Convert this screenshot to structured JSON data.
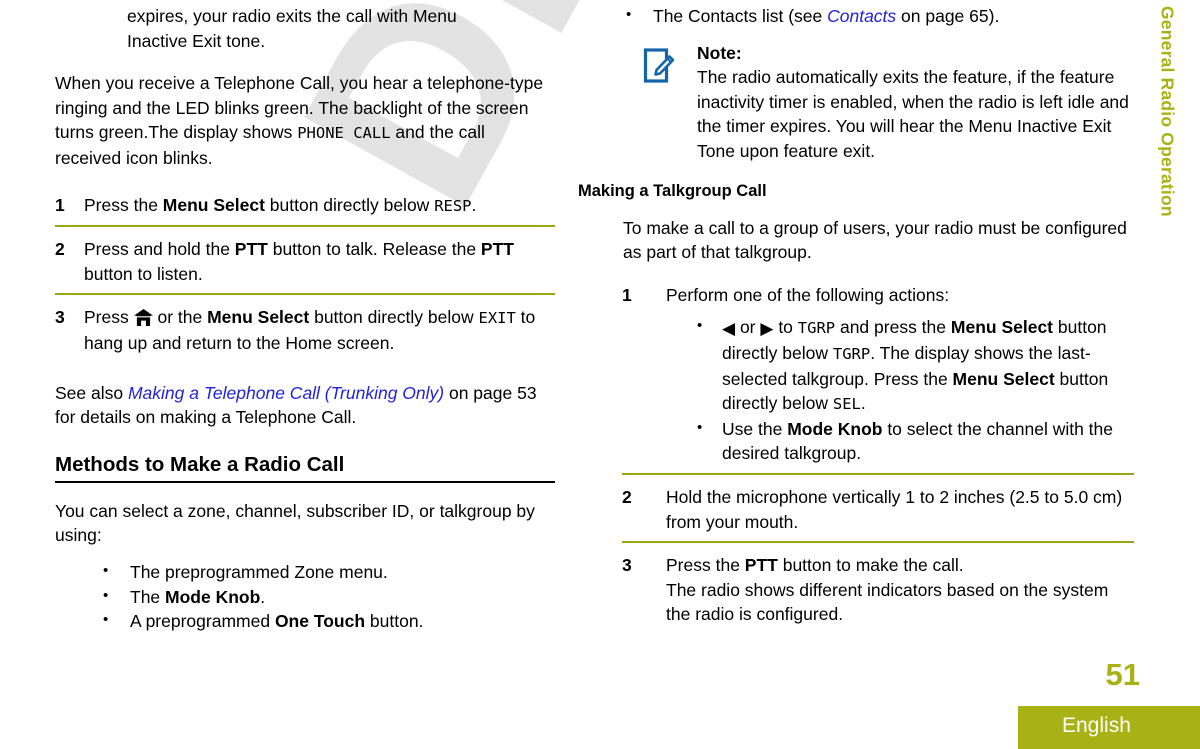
{
  "watermark": {
    "text": "Draft"
  },
  "side_tab": {
    "label": "General Radio Operation",
    "color": "#a8b214"
  },
  "page_number": "51",
  "footer": {
    "language": "English",
    "bar_color": "#a8b214",
    "text_color": "#ffffff"
  },
  "accent": {
    "rule_olive": "#9aa515",
    "rule_black": "#000000",
    "link_blue": "#2222dd",
    "note_icon_blue": "#1464aa"
  },
  "left_column": {
    "continued_paragraph": {
      "line1": "expires, your radio exits the call with Menu",
      "line2": "Inactive Exit tone."
    },
    "telephone_call_paragraph": {
      "text_before": "When you receive a Telephone Call, you hear a telephone-type ringing and the LED blinks green. The backlight of the screen turns green.The display shows ",
      "display_text": "PHONE CALL",
      "text_after": " and the call received icon blinks."
    },
    "steps": [
      {
        "num": "1",
        "parts": [
          {
            "type": "text",
            "value": "Press the "
          },
          {
            "type": "bold",
            "value": "Menu Select"
          },
          {
            "type": "text",
            "value": " button directly below "
          },
          {
            "type": "lcd",
            "value": "RESP"
          },
          {
            "type": "text",
            "value": "."
          }
        ]
      },
      {
        "num": "2",
        "parts": [
          {
            "type": "text",
            "value": "Press and hold the "
          },
          {
            "type": "bold",
            "value": "PTT"
          },
          {
            "type": "text",
            "value": " button to talk. Release the "
          },
          {
            "type": "bold",
            "value": "PTT"
          },
          {
            "type": "text",
            "value": " button to listen."
          }
        ]
      },
      {
        "num": "3",
        "parts": [
          {
            "type": "text",
            "value": "Press "
          },
          {
            "type": "icon",
            "value": "home-icon"
          },
          {
            "type": "text",
            "value": " or the "
          },
          {
            "type": "bold",
            "value": "Menu Select"
          },
          {
            "type": "text",
            "value": " button directly below "
          },
          {
            "type": "lcd",
            "value": "EXIT"
          },
          {
            "type": "text",
            "value": " to hang up and return to the Home screen."
          }
        ]
      }
    ],
    "see_also": {
      "prefix": "See also ",
      "link_text": "Making a Telephone Call (Trunking Only)",
      "suffix": " on page 53 for details on making a Telephone Call."
    },
    "heading": "Methods to Make a Radio Call",
    "intro": "You can select a zone, channel, subscriber ID, or talkgroup by using:",
    "bullets": [
      [
        {
          "type": "text",
          "value": "The preprogrammed Zone menu."
        }
      ],
      [
        {
          "type": "text",
          "value": "The "
        },
        {
          "type": "bold",
          "value": "Mode Knob"
        },
        {
          "type": "text",
          "value": "."
        }
      ],
      [
        {
          "type": "text",
          "value": "A preprogrammed "
        },
        {
          "type": "bold",
          "value": "One Touch"
        },
        {
          "type": "text",
          "value": " button."
        }
      ]
    ]
  },
  "right_column": {
    "contacts_bullet": {
      "prefix": "The Contacts list (see ",
      "link_text": "Contacts",
      "suffix": " on page 65)."
    },
    "note": {
      "icon": "note-pencil-icon",
      "title": "Note:",
      "body": "The radio automatically exits the feature, if the feature inactivity timer is enabled, when the radio is left idle and the timer expires. You will hear the Menu Inactive Exit Tone upon feature exit."
    },
    "heading": "Making a Talkgroup Call",
    "intro": "To make a call to a group of users, your radio must be configured as part of that talkgroup.",
    "steps": [
      {
        "num": "1",
        "lead": "Perform one of the following actions:",
        "subbullets": [
          [
            {
              "type": "arrow",
              "value": "left"
            },
            {
              "type": "text",
              "value": " or "
            },
            {
              "type": "arrow",
              "value": "right"
            },
            {
              "type": "text",
              "value": " to "
            },
            {
              "type": "lcd",
              "value": "TGRP"
            },
            {
              "type": "text",
              "value": " and press the "
            },
            {
              "type": "bold",
              "value": "Menu Select"
            },
            {
              "type": "text",
              "value": " button directly below "
            },
            {
              "type": "lcd",
              "value": "TGRP"
            },
            {
              "type": "text",
              "value": ". The display shows the last-selected talkgroup. Press the "
            },
            {
              "type": "bold",
              "value": "Menu Select"
            },
            {
              "type": "text",
              "value": " button directly below "
            },
            {
              "type": "lcd",
              "value": "SEL"
            },
            {
              "type": "text",
              "value": "."
            }
          ],
          [
            {
              "type": "text",
              "value": "Use the "
            },
            {
              "type": "bold",
              "value": "Mode Knob"
            },
            {
              "type": "text",
              "value": " to select the channel with the desired talkgroup."
            }
          ]
        ]
      },
      {
        "num": "2",
        "parts": [
          {
            "type": "text",
            "value": "Hold the microphone vertically 1 to 2 inches (2.5 to 5.0 cm) from your mouth."
          }
        ]
      },
      {
        "num": "3",
        "parts": [
          {
            "type": "text",
            "value": "Press the "
          },
          {
            "type": "bold",
            "value": "PTT"
          },
          {
            "type": "text",
            "value": " button to make the call."
          },
          {
            "type": "break",
            "value": ""
          },
          {
            "type": "text",
            "value": "The radio shows different indicators based on the system the radio is configured."
          }
        ]
      }
    ]
  }
}
